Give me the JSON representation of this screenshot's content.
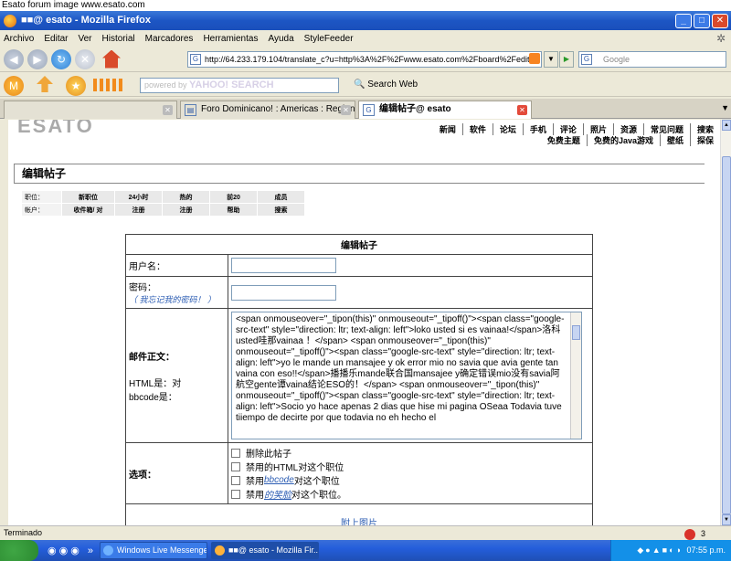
{
  "caption": "Esato forum image www.esato.com",
  "window": {
    "title": "■■@ esato - Mozilla Firefox"
  },
  "menu": [
    "Archivo",
    "Editar",
    "Ver",
    "Historial",
    "Marcadores",
    "Herramientas",
    "Ayuda",
    "StyleFeeder"
  ],
  "url": "http://64.233.179.104/translate_c?u=http%3A%2F%2Fwww.esato.com%2Fboard%2Fedit",
  "search_placeholder": "Google",
  "yahoo": {
    "placeholder": "powered by",
    "brand": "YAHOO! SEARCH"
  },
  "search_web": "Search Web",
  "tabs": [
    {
      "label": ""
    },
    {
      "label": "Foro Dominicano! : Americas : Region..."
    },
    {
      "label": "编辑帖子@ esato"
    }
  ],
  "topnav1": [
    "新闻",
    "软件",
    "论坛",
    "手机",
    "评论",
    "照片",
    "资源",
    "常见问题",
    "搜索"
  ],
  "topnav2": [
    "免费主题",
    "免费的Java游戏",
    "壁纸",
    "探保"
  ],
  "section_title": "编辑帖子",
  "mini": {
    "row1": {
      "label": "职位：",
      "cells": [
        "新职位",
        "24小时",
        "热的",
        "前20",
        "成员"
      ]
    },
    "row2": {
      "label": "帐户：",
      "cells": [
        "收件箱/ 对",
        "注册",
        "注册",
        "帮助",
        "搜索"
      ]
    }
  },
  "form": {
    "title": "编辑帖子",
    "username_label": "用户名：",
    "password_label": "密码：",
    "forgot": "（ 我忘记我的密码！ ）",
    "body_label": "邮件正文：",
    "html_note1": "HTML是：对",
    "html_note2": "bbcode是：",
    "body_text": " <span onmouseover=\"_tipon(this)\" onmouseout=\"_tipoff()\"><span class=\"google-src-text\" style=\"direction: ltr; text-align: left\">loko usted si es vainaa!</span>洛科usted哇那vainaa ！</span> <span onmouseover=\"_tipon(this)\" onmouseout=\"_tipoff()\"><span class=\"google-src-text\" style=\"direction: ltr; text-align: left\">yo le mande un mansajee y ok error mio no savia que avia gente tan vaina con eso!!</span>播播乐mande联合国mansajee y确定错误mio没有savia阿航空gente谭vaina结论ESO的！</span> <span onmouseover=\"_tipon(this)\" onmouseout=\"_tipoff()\"><span class=\"google-src-text\" style=\"direction: ltr; text-align: left\">Socio yo hace apenas 2 dias que hise mi pagina OSeaa Todavia tuve tiiempo de decirte por que todavia no eh hecho el",
    "options_label": "选项：",
    "opt1": "删除此帖子",
    "opt2": "禁用的HTML对这个职位",
    "opt3_pre": "禁用",
    "opt3_link": "bbcode",
    "opt3_post": "对这个职位",
    "opt4_pre": "禁用",
    "opt4_link": "的笑脸",
    "opt4_post": "对这个职位。",
    "attach": "附上图片"
  },
  "status": {
    "text": "Terminado",
    "count": "3"
  },
  "taskbar": {
    "start": "",
    "items": [
      "Windows Live Messenger",
      "■■@ esato - Mozilla Fir..."
    ],
    "time": "07:55 p.m."
  }
}
